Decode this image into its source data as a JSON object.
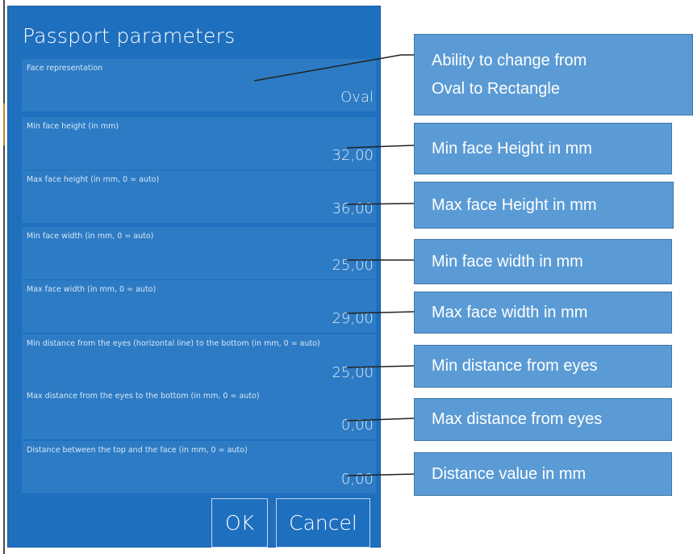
{
  "dialog": {
    "title": "Passport parameters",
    "fields": [
      {
        "label": "Face representation",
        "value": "Oval"
      },
      {
        "label": "Min face height (in mm)",
        "value": "32,00"
      },
      {
        "label": "Max face height (in mm, 0 = auto)",
        "value": "36,00"
      },
      {
        "label": "Min face width (in mm, 0 = auto)",
        "value": "25,00"
      },
      {
        "label": "Max face width (in mm, 0 = auto)",
        "value": "29,00"
      },
      {
        "label": "Min distance from the eyes (horizontal line) to the bottom (in mm, 0 = auto)",
        "value": "25,00"
      },
      {
        "label": "Max distance from the eyes to the bottom (in mm, 0 = auto)",
        "value": "0,00"
      },
      {
        "label": "Distance between the top and the face (in mm, 0 = auto)",
        "value": "0,00"
      }
    ],
    "ok_label": "OK",
    "cancel_label": "Cancel"
  },
  "callouts": {
    "face_representation_line1": "Ability to change from",
    "face_representation_line2": "Oval to Rectangle",
    "min_face_height": "Min face Height in mm",
    "max_face_height": "Max face Height in mm",
    "min_face_width": "Min face width in mm",
    "max_face_width": "Max face width in mm",
    "min_distance_eyes": "Min distance from eyes",
    "max_distance_eyes": "Max distance from eyes",
    "distance_value": "Distance value in mm"
  },
  "colors": {
    "dialog_bg": "#1f6fbf",
    "field_bg": "#2d7bc4",
    "callout_bg": "#5b9bd5"
  }
}
